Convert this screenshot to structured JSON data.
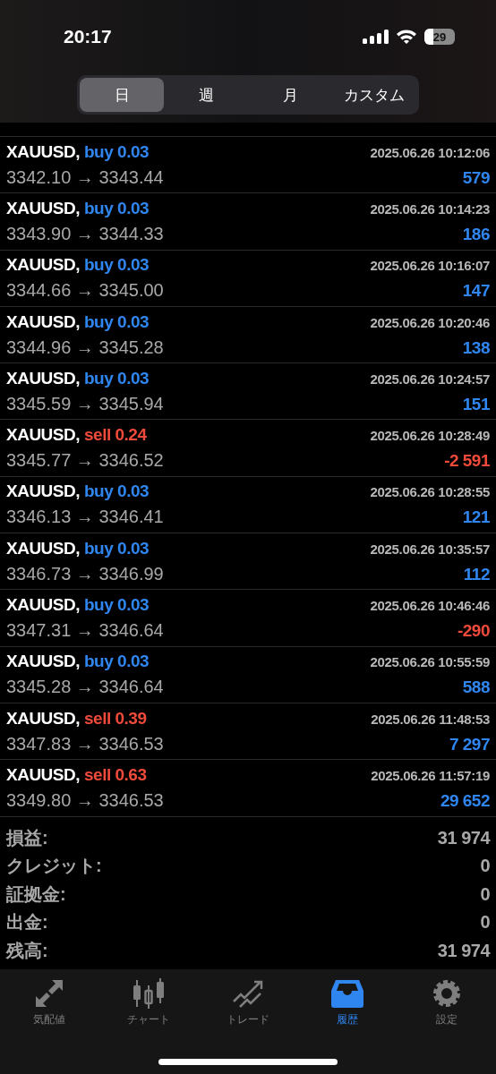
{
  "status_bar": {
    "time": "20:17",
    "battery": "29"
  },
  "period_tabs": [
    {
      "label": "日",
      "selected": true
    },
    {
      "label": "週",
      "selected": false
    },
    {
      "label": "月",
      "selected": false
    },
    {
      "label": "カスタム",
      "selected": false
    }
  ],
  "deals": [
    {
      "symbol": "XAUUSD,",
      "kind": "buy",
      "trade": "buy 0.03",
      "time": "2025.06.26 10:12:06",
      "prices": "3342.10 → 3343.44",
      "profit": "579",
      "negative": false
    },
    {
      "symbol": "XAUUSD,",
      "kind": "buy",
      "trade": "buy 0.03",
      "time": "2025.06.26 10:14:23",
      "prices": "3343.90 → 3344.33",
      "profit": "186",
      "negative": false
    },
    {
      "symbol": "XAUUSD,",
      "kind": "buy",
      "trade": "buy 0.03",
      "time": "2025.06.26 10:16:07",
      "prices": "3344.66 → 3345.00",
      "profit": "147",
      "negative": false
    },
    {
      "symbol": "XAUUSD,",
      "kind": "buy",
      "trade": "buy 0.03",
      "time": "2025.06.26 10:20:46",
      "prices": "3344.96 → 3345.28",
      "profit": "138",
      "negative": false
    },
    {
      "symbol": "XAUUSD,",
      "kind": "buy",
      "trade": "buy 0.03",
      "time": "2025.06.26 10:24:57",
      "prices": "3345.59 → 3345.94",
      "profit": "151",
      "negative": false
    },
    {
      "symbol": "XAUUSD,",
      "kind": "sell",
      "trade": "sell 0.24",
      "time": "2025.06.26 10:28:49",
      "prices": "3345.77 → 3346.52",
      "profit": "-2 591",
      "negative": true
    },
    {
      "symbol": "XAUUSD,",
      "kind": "buy",
      "trade": "buy 0.03",
      "time": "2025.06.26 10:28:55",
      "prices": "3346.13 → 3346.41",
      "profit": "121",
      "negative": false
    },
    {
      "symbol": "XAUUSD,",
      "kind": "buy",
      "trade": "buy 0.03",
      "time": "2025.06.26 10:35:57",
      "prices": "3346.73 → 3346.99",
      "profit": "112",
      "negative": false
    },
    {
      "symbol": "XAUUSD,",
      "kind": "buy",
      "trade": "buy 0.03",
      "time": "2025.06.26 10:46:46",
      "prices": "3347.31 → 3346.64",
      "profit": "-290",
      "negative": true
    },
    {
      "symbol": "XAUUSD,",
      "kind": "buy",
      "trade": "buy 0.03",
      "time": "2025.06.26 10:55:59",
      "prices": "3345.28 → 3346.64",
      "profit": "588",
      "negative": false
    },
    {
      "symbol": "XAUUSD,",
      "kind": "sell",
      "trade": "sell 0.39",
      "time": "2025.06.26 11:48:53",
      "prices": "3347.83 → 3346.53",
      "profit": "7 297",
      "negative": false
    },
    {
      "symbol": "XAUUSD,",
      "kind": "sell",
      "trade": "sell 0.63",
      "time": "2025.06.26 11:57:19",
      "prices": "3349.80 → 3346.53",
      "profit": "29 652",
      "negative": false
    }
  ],
  "summary": [
    {
      "label": "損益:",
      "value": "31 974"
    },
    {
      "label": "クレジット:",
      "value": "0"
    },
    {
      "label": "証拠金:",
      "value": "0"
    },
    {
      "label": "出金:",
      "value": "0"
    },
    {
      "label": "残高:",
      "value": "31 974"
    }
  ],
  "tab_bar": [
    {
      "kind": "quotes",
      "label": "気配値",
      "selected": false
    },
    {
      "kind": "chart",
      "label": "チャート",
      "selected": false
    },
    {
      "kind": "trade",
      "label": "トレード",
      "selected": false
    },
    {
      "kind": "history",
      "label": "履歴",
      "selected": true
    },
    {
      "kind": "settings",
      "label": "設定",
      "selected": false
    }
  ]
}
